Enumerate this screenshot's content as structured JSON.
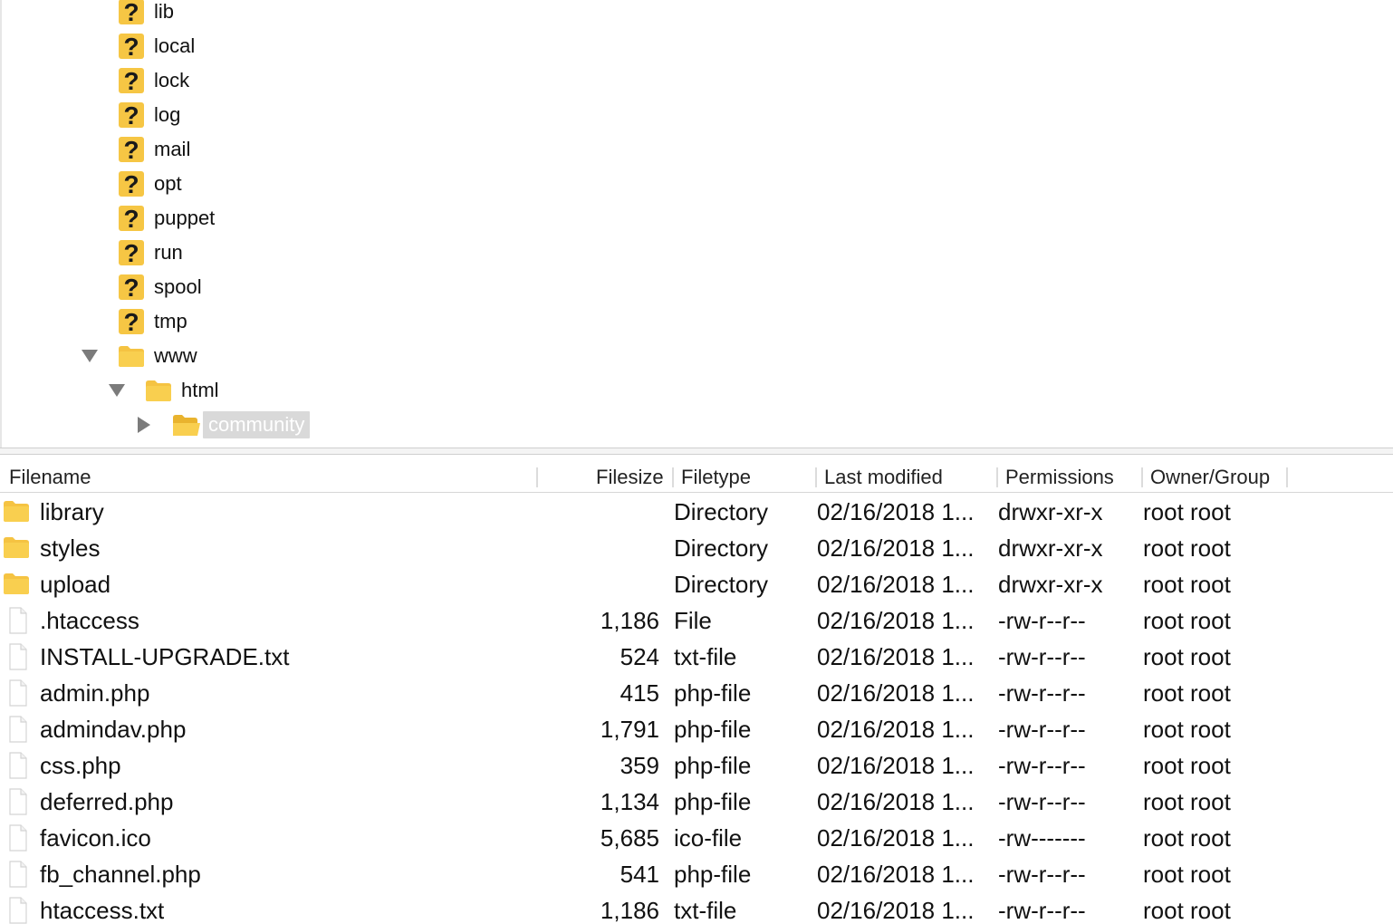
{
  "tree": {
    "items": [
      {
        "label": "lib",
        "icon": "question-icon"
      },
      {
        "label": "local",
        "icon": "question-icon"
      },
      {
        "label": "lock",
        "icon": "question-icon"
      },
      {
        "label": "log",
        "icon": "question-icon"
      },
      {
        "label": "mail",
        "icon": "question-icon"
      },
      {
        "label": "opt",
        "icon": "question-icon"
      },
      {
        "label": "puppet",
        "icon": "question-icon"
      },
      {
        "label": "run",
        "icon": "question-icon"
      },
      {
        "label": "spool",
        "icon": "question-icon"
      },
      {
        "label": "tmp",
        "icon": "question-icon"
      },
      {
        "label": "www",
        "icon": "folder-icon",
        "expanded": true
      },
      {
        "label": "html",
        "icon": "folder-icon",
        "expanded": true
      },
      {
        "label": "community",
        "icon": "folder-open-icon",
        "expanded": false,
        "selected": true
      }
    ]
  },
  "list": {
    "columns": {
      "filename": "Filename",
      "filesize": "Filesize",
      "filetype": "Filetype",
      "last_modified": "Last modified",
      "permissions": "Permissions",
      "owner_group": "Owner/Group"
    },
    "rows": [
      {
        "name": "library",
        "size": "",
        "type": "Directory",
        "modified": "02/16/2018 1...",
        "perms": "drwxr-xr-x",
        "owner": "root root",
        "icon": "folder-icon"
      },
      {
        "name": "styles",
        "size": "",
        "type": "Directory",
        "modified": "02/16/2018 1...",
        "perms": "drwxr-xr-x",
        "owner": "root root",
        "icon": "folder-icon"
      },
      {
        "name": "upload",
        "size": "",
        "type": "Directory",
        "modified": "02/16/2018 1...",
        "perms": "drwxr-xr-x",
        "owner": "root root",
        "icon": "folder-icon"
      },
      {
        "name": ".htaccess",
        "size": "1,186",
        "type": "File",
        "modified": "02/16/2018 1...",
        "perms": "-rw-r--r--",
        "owner": "root root",
        "icon": "file-icon"
      },
      {
        "name": "INSTALL-UPGRADE.txt",
        "size": "524",
        "type": "txt-file",
        "modified": "02/16/2018 1...",
        "perms": "-rw-r--r--",
        "owner": "root root",
        "icon": "file-icon"
      },
      {
        "name": "admin.php",
        "size": "415",
        "type": "php-file",
        "modified": "02/16/2018 1...",
        "perms": "-rw-r--r--",
        "owner": "root root",
        "icon": "file-icon"
      },
      {
        "name": "admindav.php",
        "size": "1,791",
        "type": "php-file",
        "modified": "02/16/2018 1...",
        "perms": "-rw-r--r--",
        "owner": "root root",
        "icon": "file-icon"
      },
      {
        "name": "css.php",
        "size": "359",
        "type": "php-file",
        "modified": "02/16/2018 1...",
        "perms": "-rw-r--r--",
        "owner": "root root",
        "icon": "file-icon"
      },
      {
        "name": "deferred.php",
        "size": "1,134",
        "type": "php-file",
        "modified": "02/16/2018 1...",
        "perms": "-rw-r--r--",
        "owner": "root root",
        "icon": "file-icon"
      },
      {
        "name": "favicon.ico",
        "size": "5,685",
        "type": "ico-file",
        "modified": "02/16/2018 1...",
        "perms": "-rw-------",
        "owner": "root root",
        "icon": "file-icon"
      },
      {
        "name": "fb_channel.php",
        "size": "541",
        "type": "php-file",
        "modified": "02/16/2018 1...",
        "perms": "-rw-r--r--",
        "owner": "root root",
        "icon": "file-icon"
      },
      {
        "name": "htaccess.txt",
        "size": "1,186",
        "type": "txt-file",
        "modified": "02/16/2018 1...",
        "perms": "-rw-r--r--",
        "owner": "root root",
        "icon": "file-icon"
      }
    ]
  },
  "colors": {
    "folder": "#f5c342",
    "question_fill": "#f6c644",
    "selection": "#d9d9d9"
  }
}
